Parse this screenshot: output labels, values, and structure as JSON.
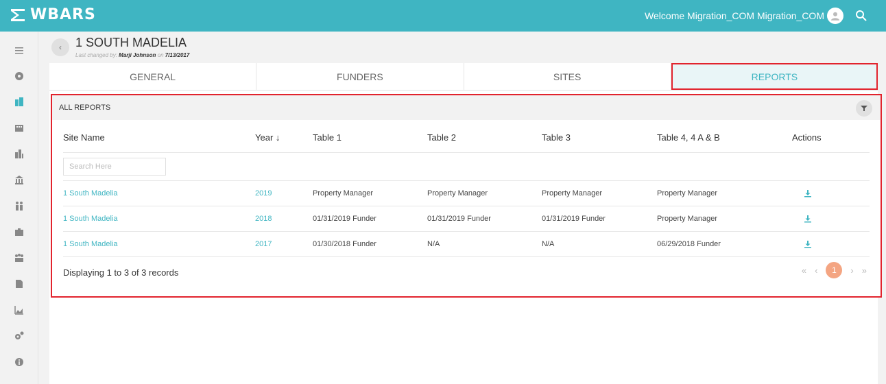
{
  "app": {
    "logo_text": "WBARS",
    "welcome": "Welcome Migration_COM Migration_COM",
    "icons": [
      "wbars-logo-icon",
      "user-avatar-icon",
      "search-icon"
    ]
  },
  "sidebar": {
    "items": [
      {
        "name": "menu-icon"
      },
      {
        "name": "dashboard-icon"
      },
      {
        "name": "property-icon"
      },
      {
        "name": "buildings-icon"
      },
      {
        "name": "city-icon"
      },
      {
        "name": "bank-icon"
      },
      {
        "name": "people-icon"
      },
      {
        "name": "briefcase-icon"
      },
      {
        "name": "group-icon"
      },
      {
        "name": "document-icon"
      },
      {
        "name": "area-chart-icon"
      },
      {
        "name": "settings-icon"
      },
      {
        "name": "info-icon"
      }
    ],
    "active_index": 2
  },
  "page": {
    "title": "1 SOUTH MADELIA",
    "last_changed_prefix": "Last changed by: ",
    "last_changed_by": "Marji Johnson",
    "last_changed_on_prefix": " on ",
    "last_changed_on": "7/13/2017"
  },
  "tabs": [
    {
      "label": "GENERAL"
    },
    {
      "label": "FUNDERS"
    },
    {
      "label": "SITES"
    },
    {
      "label": "REPORTS",
      "active": true
    }
  ],
  "reports": {
    "section_title": "ALL REPORTS",
    "columns": [
      "Site Name",
      "Year ↓",
      "Table 1",
      "Table 2",
      "Table 3",
      "Table 4, 4 A & B",
      "Actions"
    ],
    "search_placeholder": "Search Here",
    "rows": [
      {
        "site": "1 South Madelia",
        "year": "2019",
        "t1": "Property Manager",
        "t2": "Property Manager",
        "t3": "Property Manager",
        "t4": "Property Manager"
      },
      {
        "site": "1 South Madelia",
        "year": "2018",
        "t1": "01/31/2019 Funder",
        "t2": "01/31/2019 Funder",
        "t3": "01/31/2019 Funder",
        "t4": "Property Manager"
      },
      {
        "site": "1 South Madelia",
        "year": "2017",
        "t1": "01/30/2018 Funder",
        "t2": "N/A",
        "t3": "N/A",
        "t4": "06/29/2018 Funder"
      }
    ],
    "footer": "Displaying 1 to 3 of 3 records",
    "pager": {
      "first": "«",
      "prev": "‹",
      "current": "1",
      "next": "›",
      "last": "»"
    }
  },
  "colors": {
    "brand": "#3fb5c2",
    "highlight": "#e2232d",
    "pager_active": "#f4a582"
  }
}
